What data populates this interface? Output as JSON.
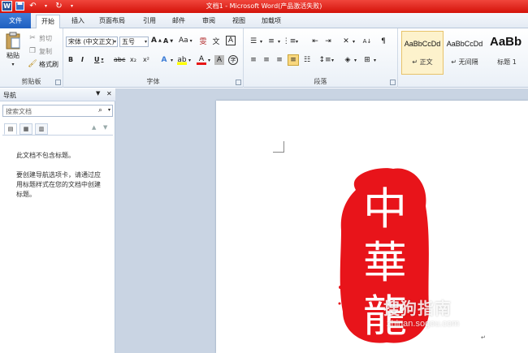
{
  "window": {
    "title": "文档1 - Microsoft Word(产品激活失败)"
  },
  "tabs": [
    {
      "label": "文件"
    },
    {
      "label": "开始"
    },
    {
      "label": "插入"
    },
    {
      "label": "页面布局"
    },
    {
      "label": "引用"
    },
    {
      "label": "邮件"
    },
    {
      "label": "审阅"
    },
    {
      "label": "视图"
    },
    {
      "label": "加载项"
    }
  ],
  "ribbon": {
    "clipboard": {
      "label": "剪贴板",
      "paste": "粘贴",
      "cut": "剪切",
      "copy": "复制",
      "format_painter": "格式刷"
    },
    "font": {
      "label": "字体",
      "font_name": "宋体 (中文正文)",
      "font_size": "五号",
      "grow": "A",
      "shrink": "A",
      "case": "Aa",
      "bold": "B",
      "italic": "I",
      "underline": "U",
      "strike": "abc",
      "sub": "x₂",
      "sup": "x²",
      "clear": "A"
    },
    "paragraph": {
      "label": "段落"
    },
    "styles": [
      {
        "sample": "AaBbCcDd",
        "name": "↵ 正文",
        "selected": true
      },
      {
        "sample": "AaBbCcDd",
        "name": "↵ 无间隔",
        "selected": false
      },
      {
        "sample": "AaBb",
        "name": "标题 1",
        "selected": false
      }
    ]
  },
  "nav": {
    "title": "导航",
    "search_placeholder": "搜索文档",
    "msg1": "此文档不包含标题。",
    "msg2": "要创建导航选项卡，请通过应用标题样式在您的文档中创建标题。"
  },
  "seal": {
    "chars": [
      "中",
      "華",
      "龍"
    ],
    "color": "#e8141a"
  },
  "watermark": {
    "title": "搜狗指南",
    "url": "zhinan.sogou.com"
  },
  "colors": {
    "titlebar": "#e21b12",
    "accent": "#2b579a"
  }
}
